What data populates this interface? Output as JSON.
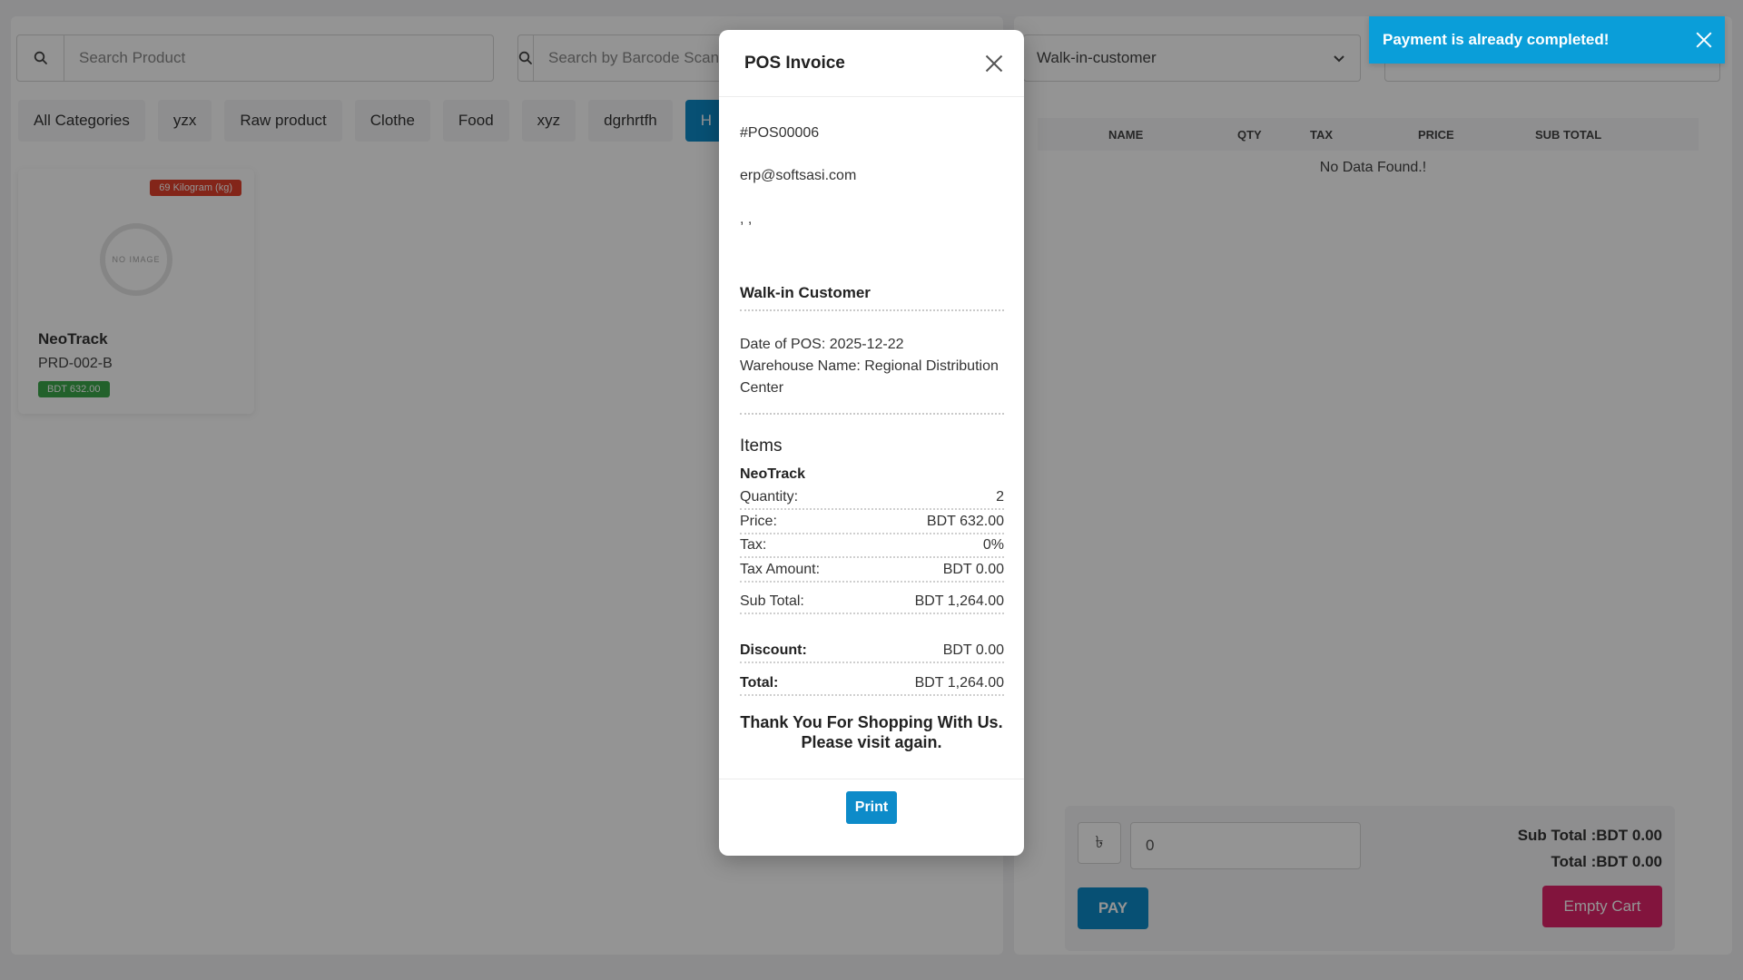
{
  "left": {
    "search_product_placeholder": "Search Product",
    "search_barcode_placeholder": "Search by Barcode Scanner",
    "categories": [
      "All Categories",
      "yzx",
      "Raw product",
      "Clothe",
      "Food",
      "xyz",
      "dgrhrtfh",
      "H"
    ],
    "product": {
      "stock_badge": "69 Kilogram (kg)",
      "image_text": "NO IMAGE",
      "name": "NeoTrack",
      "code": "PRD-002-B",
      "price": "BDT 632.00"
    }
  },
  "right": {
    "customer_select": "Walk-in-customer",
    "cart_columns": [
      "NAME",
      "QTY",
      "TAX",
      "PRICE",
      "SUB TOTAL"
    ],
    "no_data": "No Data Found.!",
    "currency_symbol": "৳",
    "amount_value": "0",
    "sub_total": "Sub Total :BDT 0.00",
    "total": "Total :BDT 0.00",
    "pay_label": "PAY",
    "empty_cart_label": "Empty Cart"
  },
  "modal": {
    "title": "POS Invoice",
    "invoice_number": "#POS00006",
    "email": "erp@softsasi.com",
    "address": ", ,",
    "customer": "Walk-in Customer",
    "date_line": "Date of POS: 2025-12-22",
    "warehouse_line": "Warehouse Name: Regional Distribution Center",
    "items_heading": "Items",
    "item_name": "NeoTrack",
    "rows": [
      {
        "label": "Quantity:",
        "value": "2"
      },
      {
        "label": "Price:",
        "value": "BDT 632.00"
      },
      {
        "label": "Tax:",
        "value": "0%"
      },
      {
        "label": "Tax Amount:",
        "value": "BDT 0.00"
      },
      {
        "label": "Sub Total:",
        "value": "BDT 1,264.00"
      },
      {
        "label": "Discount:",
        "value": "BDT 0.00"
      },
      {
        "label": "Total:",
        "value": "BDT 1,264.00"
      }
    ],
    "thanks_line1": "Thank You For Shopping With Us.",
    "thanks_line2": "Please visit again.",
    "print_label": "Print"
  },
  "toast": {
    "message": "Payment is already completed!"
  },
  "colors": {
    "primary": "#0d8bc9",
    "toast": "#0a9ed9",
    "danger": "#e0246a",
    "stock_badge": "#e2412b",
    "price_badge": "#3ba84a"
  }
}
